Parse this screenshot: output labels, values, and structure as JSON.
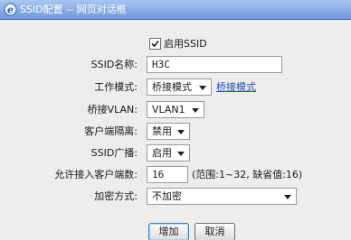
{
  "window": {
    "title": "SSID配置 -- 网页对话框"
  },
  "form": {
    "enable_ssid": {
      "label": "启用SSID",
      "checked": true
    },
    "ssid_name": {
      "label": "SSID名称:",
      "value": "H3C"
    },
    "work_mode": {
      "label": "工作模式:",
      "value": "桥接模式",
      "link": "桥接模式"
    },
    "bridge_vlan": {
      "label": "桥接VLAN:",
      "value": "VLAN1"
    },
    "client_isolation": {
      "label": "客户端隔离:",
      "value": "禁用"
    },
    "ssid_broadcast": {
      "label": "SSID广播:",
      "value": "启用"
    },
    "max_clients": {
      "label": "允许接入客户端数:",
      "value": "16",
      "hint": "(范围:1~32, 缺省值:16)"
    },
    "encryption": {
      "label": "加密方式:",
      "value": "不加密"
    }
  },
  "buttons": {
    "add": "增加",
    "cancel": "取消"
  }
}
